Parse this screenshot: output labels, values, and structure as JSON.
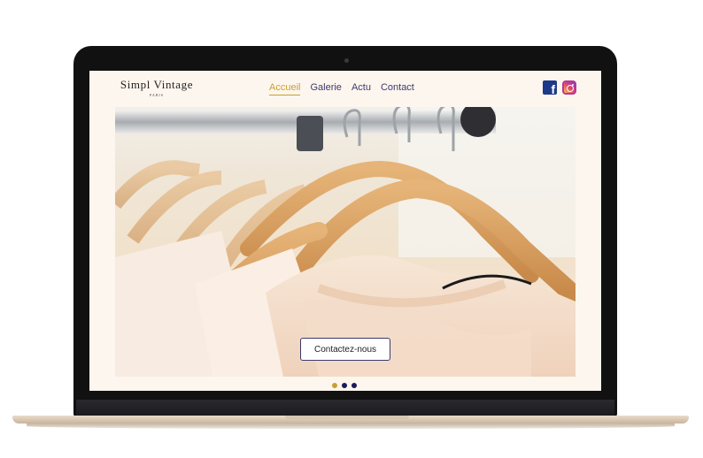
{
  "brand": {
    "name": "Simpl Vintage",
    "city": "PARIS"
  },
  "nav": {
    "items": [
      {
        "label": "Accueil",
        "active": true
      },
      {
        "label": "Galerie",
        "active": false
      },
      {
        "label": "Actu",
        "active": false
      },
      {
        "label": "Contact",
        "active": false
      }
    ]
  },
  "social": {
    "facebook_glyph": "f",
    "icons": [
      "facebook-icon",
      "instagram-icon"
    ]
  },
  "hero": {
    "cta_label": "Contactez-nous",
    "image": "clothes-on-wooden-hangers"
  },
  "carousel": {
    "slides": 3,
    "active_index": 0
  },
  "colors": {
    "accent": "#c8a02e",
    "nav": "#3c3a6e",
    "page_bg": "#fdf6ee",
    "dot": "#1a1a5a"
  }
}
